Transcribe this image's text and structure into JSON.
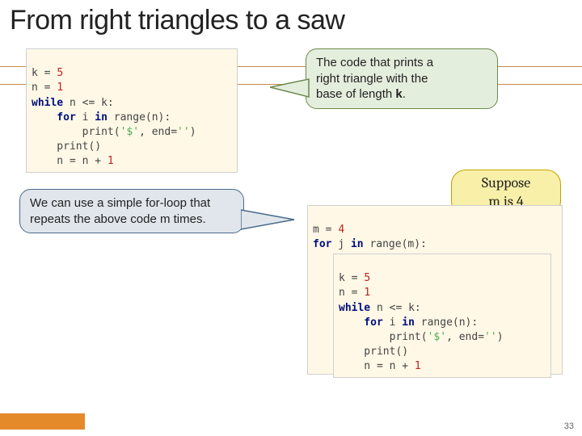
{
  "title": "From right triangles to a saw",
  "code1": {
    "l1a": "k = ",
    "l1n": "5",
    "l2a": "n = ",
    "l2n": "1",
    "l3a": "while",
    "l3b": " n <= k:",
    "l4a": "    for",
    "l4b": " i ",
    "l4c": "in",
    "l4d": " range(n):",
    "l5a": "        print(",
    "l5s": "'$'",
    "l5b": ", end=",
    "l5s2": "''",
    "l5c": ")",
    "l6a": "    print()",
    "l7a": "    n = n + ",
    "l7n": "1"
  },
  "callout_top": "The code that prints a\nright triangle with the\nbase of length ",
  "callout_top_bold": "k",
  "callout_top_end": ".",
  "callout_left": "We can use a simple for-loop that repeats the above code m times.",
  "callout_yellow_a": "Suppose",
  "callout_yellow_b": "m is 4",
  "code2": {
    "l1a": "m = ",
    "l1n": "4",
    "l2a": "for",
    "l2b": " j ",
    "l2c": "in",
    "l2d": " range(m):"
  },
  "page_num": "33"
}
